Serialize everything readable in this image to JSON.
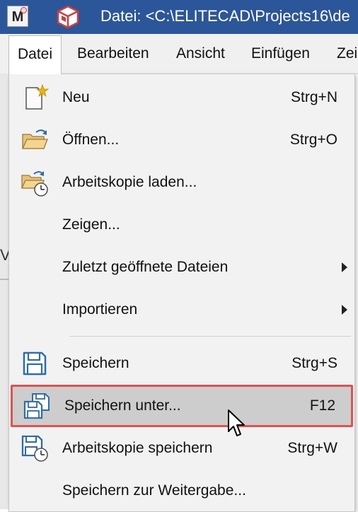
{
  "titlebar": {
    "app_letter": "M",
    "title": "Datei: <C:\\ELITECAD\\Projects16\\de"
  },
  "menubar": {
    "items": [
      {
        "label": "Datei"
      },
      {
        "label": "Bearbeiten"
      },
      {
        "label": "Ansicht"
      },
      {
        "label": "Einfügen"
      },
      {
        "label": "Zei"
      }
    ]
  },
  "background": {
    "partial_letter": "V"
  },
  "file_menu": {
    "items": [
      {
        "label": "Neu",
        "shortcut": "Strg+N",
        "icon": "new-document-icon"
      },
      {
        "label": "Öffnen...",
        "shortcut": "Strg+O",
        "icon": "open-folder-icon"
      },
      {
        "label": "Arbeitskopie laden...",
        "shortcut": "",
        "icon": "load-working-copy-icon"
      },
      {
        "label": "Zeigen...",
        "shortcut": ""
      },
      {
        "label": "Zuletzt geöffnete Dateien",
        "shortcut": "",
        "submenu": true
      },
      {
        "label": "Importieren",
        "shortcut": "",
        "submenu": true
      },
      {
        "label": "Speichern",
        "shortcut": "Strg+S",
        "icon": "save-icon"
      },
      {
        "label": "Speichern unter...",
        "shortcut": "F12",
        "icon": "save-as-icon",
        "highlighted": true
      },
      {
        "label": "Arbeitskopie speichern",
        "shortcut": "Strg+W",
        "icon": "save-working-copy-icon"
      },
      {
        "label": "Speichern zur Weitergabe...",
        "shortcut": ""
      }
    ]
  },
  "colors": {
    "titlebar": "#2b579a",
    "highlight_border": "#e05252",
    "highlight_bg": "#cdcdcd",
    "save_icon": "#2b6cb0"
  }
}
